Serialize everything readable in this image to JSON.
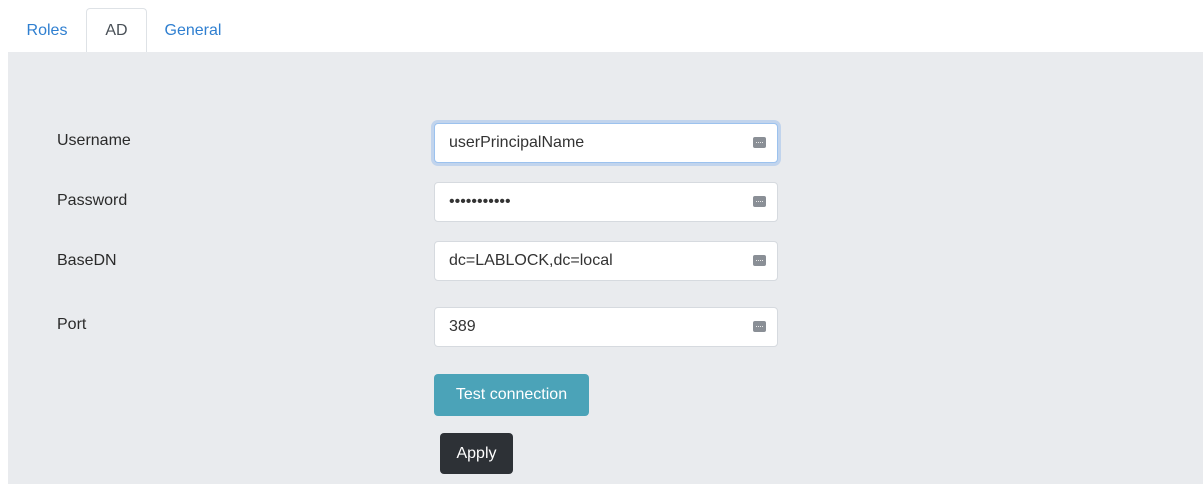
{
  "tabs": [
    {
      "label": "Roles",
      "active": false
    },
    {
      "label": "AD",
      "active": true
    },
    {
      "label": "General",
      "active": false
    }
  ],
  "form": {
    "username": {
      "label": "Username",
      "value": "userPrincipalName"
    },
    "password": {
      "label": "Password",
      "value": "•••••••••••"
    },
    "basedn": {
      "label": "BaseDN",
      "value": "dc=LABLOCK,dc=local"
    },
    "port": {
      "label": "Port",
      "value": "389"
    }
  },
  "buttons": {
    "test_connection": "Test connection",
    "apply": "Apply"
  },
  "icons": {
    "field_icon": "password-manager-key-icon"
  },
  "colors": {
    "tab_link": "#2f7fd0",
    "panel_bg": "#e9ebee",
    "test_button": "#4ba3b8",
    "apply_button": "#2d3136"
  }
}
